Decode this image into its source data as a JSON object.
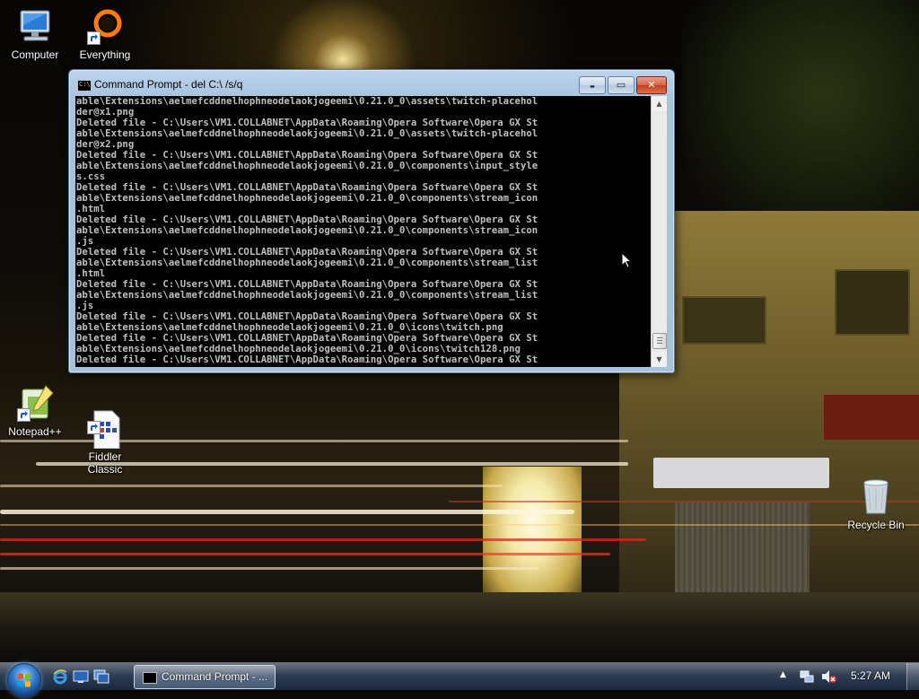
{
  "desktop": {
    "icons": [
      {
        "label": "Computer",
        "icon": "computer-icon"
      },
      {
        "label": "Everything",
        "icon": "everything-search-icon"
      },
      {
        "label": "Notepad++",
        "icon": "notepadpp-icon"
      },
      {
        "label": "Fiddler\nClassic",
        "icon": "fiddler-icon"
      },
      {
        "label": "Recycle Bin",
        "icon": "recycle-bin-icon"
      }
    ]
  },
  "console_window": {
    "title": "Command Prompt - del  C:\\ /s/q",
    "buttons": {
      "minimize": "▬",
      "maximize": "▭",
      "close": "✕"
    },
    "output": "able\\Extensions\\aelmefcddnelhophneodelaokjogeemi\\0.21.0_0\\assets\\twitch-placehol\nder@x1.png\nDeleted file - C:\\Users\\VM1.COLLABNET\\AppData\\Roaming\\Opera Software\\Opera GX St\nable\\Extensions\\aelmefcddnelhophneodelaokjogeemi\\0.21.0_0\\assets\\twitch-placehol\nder@x2.png\nDeleted file - C:\\Users\\VM1.COLLABNET\\AppData\\Roaming\\Opera Software\\Opera GX St\nable\\Extensions\\aelmefcddnelhophneodelaokjogeemi\\0.21.0_0\\components\\input_style\ns.css\nDeleted file - C:\\Users\\VM1.COLLABNET\\AppData\\Roaming\\Opera Software\\Opera GX St\nable\\Extensions\\aelmefcddnelhophneodelaokjogeemi\\0.21.0_0\\components\\stream_icon\n.html\nDeleted file - C:\\Users\\VM1.COLLABNET\\AppData\\Roaming\\Opera Software\\Opera GX St\nable\\Extensions\\aelmefcddnelhophneodelaokjogeemi\\0.21.0_0\\components\\stream_icon\n.js\nDeleted file - C:\\Users\\VM1.COLLABNET\\AppData\\Roaming\\Opera Software\\Opera GX St\nable\\Extensions\\aelmefcddnelhophneodelaokjogeemi\\0.21.0_0\\components\\stream_list\n.html\nDeleted file - C:\\Users\\VM1.COLLABNET\\AppData\\Roaming\\Opera Software\\Opera GX St\nable\\Extensions\\aelmefcddnelhophneodelaokjogeemi\\0.21.0_0\\components\\stream_list\n.js\nDeleted file - C:\\Users\\VM1.COLLABNET\\AppData\\Roaming\\Opera Software\\Opera GX St\nable\\Extensions\\aelmefcddnelhophneodelaokjogeemi\\0.21.0_0\\icons\\twitch.png\nDeleted file - C:\\Users\\VM1.COLLABNET\\AppData\\Roaming\\Opera Software\\Opera GX St\nable\\Extensions\\aelmefcddnelhophneodelaokjogeemi\\0.21.0_0\\icons\\twitch128.png\nDeleted file - C:\\Users\\VM1.COLLABNET\\AppData\\Roaming\\Opera Software\\Opera GX St",
    "scrollbar": {
      "up": "▲",
      "down": "▼"
    }
  },
  "taskbar": {
    "start_icon": "windows-start-orb",
    "quick_launch": [
      "internet-explorer-icon",
      "show-desktop-icon",
      "switch-windows-icon"
    ],
    "tasks": [
      {
        "label": "Command Prompt - ...",
        "icon": "command-prompt-icon"
      }
    ],
    "tray": {
      "expand": "▲",
      "icons": [
        "network-icon",
        "volume-muted-icon"
      ],
      "clock": "5:27 AM"
    }
  },
  "colors": {
    "console_bg": "#000000",
    "console_text": "#c0c0c0",
    "titlebar": "#b9d1ea",
    "close_button": "#c7472a"
  }
}
